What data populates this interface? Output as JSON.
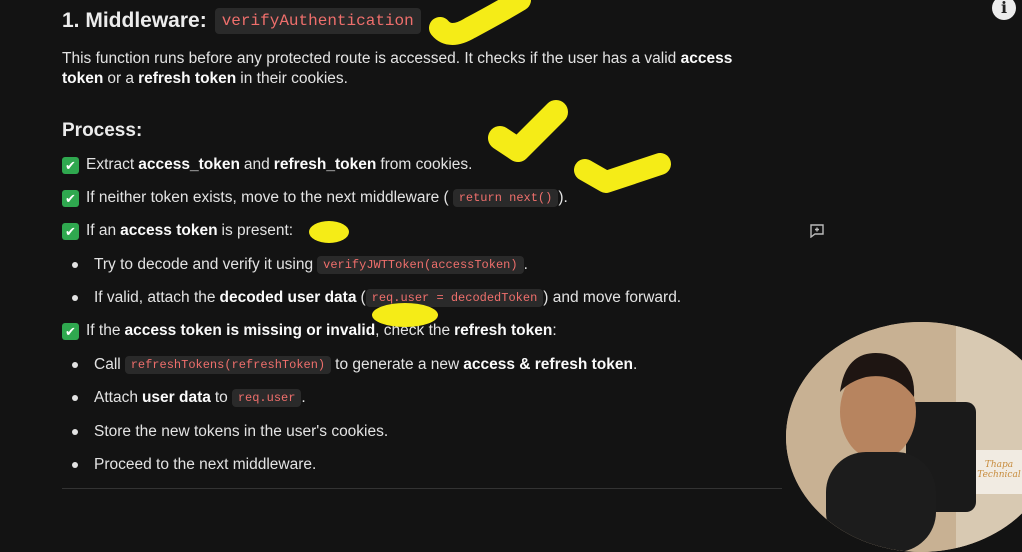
{
  "heading": {
    "prefix": "1. Middleware:",
    "code": "verifyAuthentication"
  },
  "intro": {
    "t1": "This function runs before any protected route is accessed. It checks if the user has a valid",
    "b1": "access token",
    "t2": "or a",
    "b2": "refresh token",
    "t3": "in their cookies."
  },
  "process_title": "Process:",
  "steps": [
    {
      "icon": "✔",
      "t1": "Extract",
      "b1": "access_token",
      "t2": "and",
      "b2": "refresh_token",
      "t3": "from cookies."
    },
    {
      "icon": "✔",
      "t1": "If neither token exists, move to the next middleware (",
      "code": "return next()",
      "t2": ")."
    },
    {
      "icon": "✔",
      "t1": "If an",
      "b1": "access token",
      "t2": "is present:"
    }
  ],
  "present_bullets": [
    {
      "t1": "Try to decode and verify it using",
      "code": "verifyJWTToken(accessToken)",
      "t2": "."
    },
    {
      "t1": "If valid, attach the",
      "b1": "decoded user data",
      "t2": "(",
      "code": "req.user = decodedToken",
      "t3": ") and move forward."
    }
  ],
  "missing_step": {
    "icon": "✔",
    "t1": "If the",
    "b1": "access token is missing or invalid",
    "t2": ", check the",
    "b2": "refresh token",
    "t3": ":"
  },
  "missing_bullets": [
    {
      "t1": "Call",
      "code": "refreshTokens(refreshToken)",
      "t2": "to generate a new",
      "b1": "access & refresh token",
      "t3": "."
    },
    {
      "t1": "Attach",
      "b1": "user data",
      "t2": "to",
      "code": "req.user",
      "t3": "."
    },
    {
      "t1": "Store the new tokens in the user's cookies."
    },
    {
      "t1": "Proceed to the next middleware."
    }
  ],
  "info_icon": "i",
  "logo_text": [
    "Thapa",
    "Technical"
  ],
  "colors": {
    "background": "#131313",
    "code_text": "#ef6f6c",
    "check": "#2fa84f",
    "highlighter": "#f5ec17"
  }
}
